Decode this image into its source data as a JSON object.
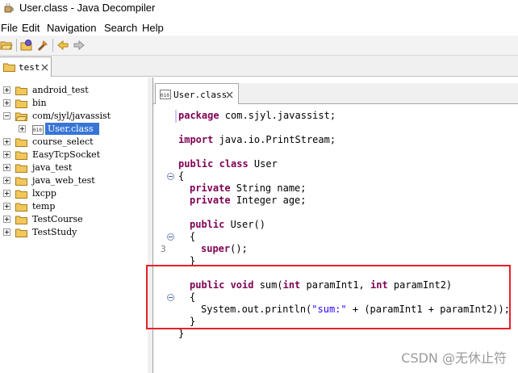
{
  "window": {
    "title": "User.class - Java Decompiler"
  },
  "menu": [
    "File",
    "Edit",
    "Navigation",
    "Search",
    "Help"
  ],
  "main_tab": {
    "label": "test"
  },
  "tree": {
    "items": [
      {
        "label": "android_test"
      },
      {
        "label": "bin"
      },
      {
        "label": "com/sjyl/javassist"
      },
      {
        "label": "User.class"
      },
      {
        "label": "course_select"
      },
      {
        "label": "EasyTcpSocket"
      },
      {
        "label": "java_test"
      },
      {
        "label": "java_web_test"
      },
      {
        "label": "lxcpp"
      },
      {
        "label": "temp"
      },
      {
        "label": "TestCourse"
      },
      {
        "label": "TestStudy"
      }
    ]
  },
  "editor": {
    "tab_label": "User.class",
    "class_icon_text": "010",
    "line_number": "3",
    "code": {
      "l1_kw": "package",
      "l1_rest": " com.sjyl.javassist;",
      "l2_kw": "import",
      "l2_rest": " java.io.PrintStream;",
      "l3_kw": "public class",
      "l3_rest": " User",
      "l4": "{",
      "l5_kw": "private",
      "l5_rest": " String name;",
      "l6_kw": "private",
      "l6_rest": " Integer age;",
      "l7_kw": "public",
      "l7_rest": " User()",
      "l8": "{",
      "l9_kw": "super",
      "l9_rest": "();",
      "l10": "}",
      "l11_kw1": "public void",
      "l11_mid1": " sum(",
      "l11_kw2": "int",
      "l11_mid2": " paramInt1, ",
      "l11_kw3": "int",
      "l11_rest": " paramInt2)",
      "l12": "{",
      "l13_a": "System.out.println(",
      "l13_str": "\"sum:\"",
      "l13_b": " + (paramInt1 + paramInt2));",
      "l14": "}",
      "l15": "}"
    }
  },
  "watermark": "CSDN @无休止符",
  "colors": {
    "keyword": "#7f0055",
    "string": "#2a00ff",
    "highlight": "#e8202a",
    "selection": "#3875d7"
  }
}
